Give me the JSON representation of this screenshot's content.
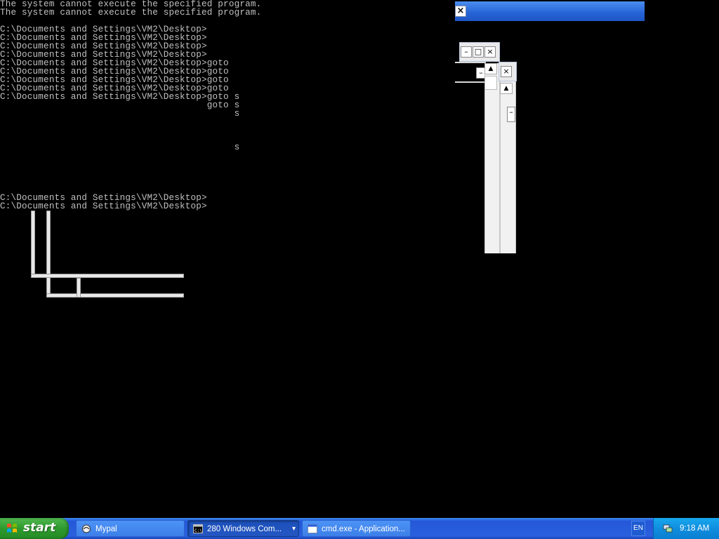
{
  "console": {
    "lines": [
      "The system cannot execute the specified program.",
      "The system cannot execute the specified program.",
      "",
      "C:\\Documents and Settings\\VM2\\Desktop>",
      "C:\\Documents and Settings\\VM2\\Desktop>",
      "C:\\Documents and Settings\\VM2\\Desktop>",
      "C:\\Documents and Settings\\VM2\\Desktop>",
      "C:\\Documents and Settings\\VM2\\Desktop>goto",
      "C:\\Documents and Settings\\VM2\\Desktop>goto",
      "C:\\Documents and Settings\\VM2\\Desktop>goto",
      "C:\\Documents and Settings\\VM2\\Desktop>goto",
      "C:\\Documents and Settings\\VM2\\Desktop>goto s",
      "                                      goto s",
      "                                           s",
      "",
      "",
      "",
      "                                           s",
      "",
      "",
      "",
      "",
      "C:\\Documents and Settings\\VM2\\Desktop>",
      "C:\\Documents and Settings\\VM2\\Desktop>"
    ]
  },
  "fragments": {
    "close_glyph": "×",
    "minimize_glyph": "–",
    "maximize_glyph": "□",
    "scroll_up_glyph": "▲"
  },
  "taskbar": {
    "start_label": "start",
    "tasks": [
      {
        "label": "Mypal",
        "icon": "mypal-browser-icon",
        "active": false
      },
      {
        "label": "280 Windows Com...",
        "icon": "console-icon",
        "active": true,
        "has_dropdown": true
      },
      {
        "label": "cmd.exe - Application...",
        "icon": "window-icon",
        "active": false
      }
    ],
    "dropdown_glyph": "▾",
    "language": "EN",
    "clock": "9:18 AM"
  },
  "colors": {
    "console_text": "#c0c0c0",
    "desktop": "#000000",
    "taskbar": "#2a5fde",
    "start": "#2e9a2e",
    "tray": "#0f8ede"
  }
}
